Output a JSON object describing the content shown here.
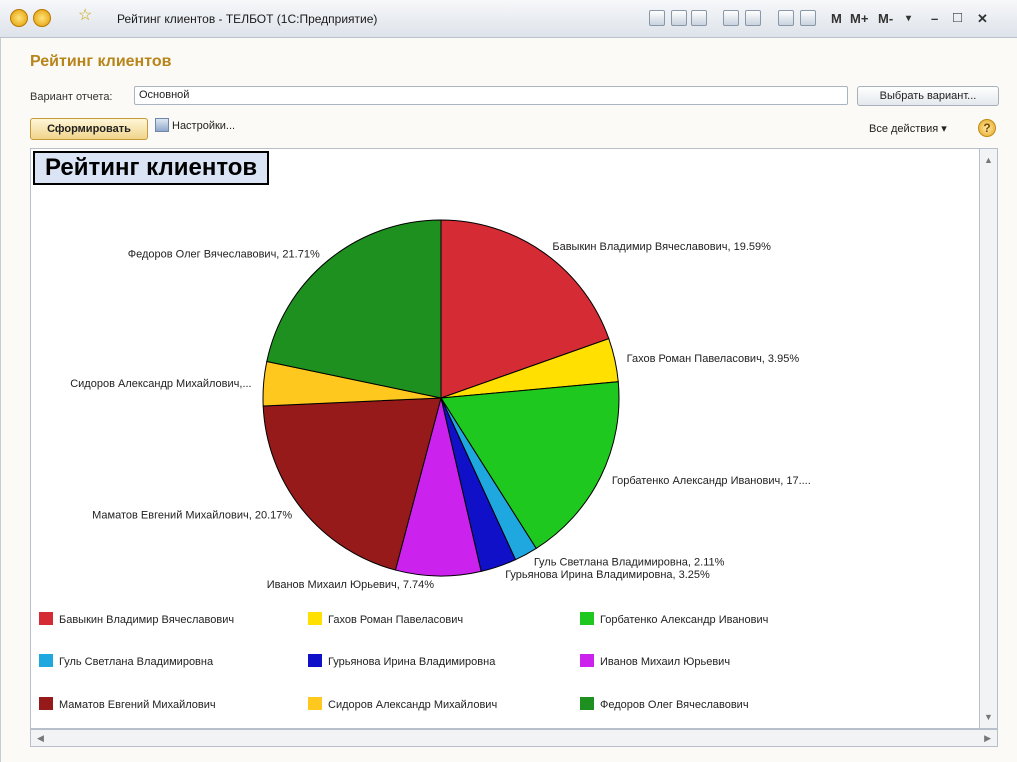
{
  "window": {
    "title": "Рейтинг клиентов - ТЕЛБОТ  (1С:Предприятие)",
    "toolbar_texts": [
      "M",
      "M+",
      "M-"
    ],
    "controls": [
      "minimize",
      "maximize",
      "close"
    ]
  },
  "form": {
    "heading": "Рейтинг клиентов",
    "variant_label": "Вариант отчета:",
    "variant_value": "Основной",
    "choose_variant_label": "Выбрать вариант...",
    "generate_label": "Сформировать",
    "settings_label": "Настройки...",
    "all_actions_label": "Все действия ▾",
    "help_label": "?"
  },
  "report": {
    "title": "Рейтинг клиентов"
  },
  "chart_data": {
    "type": "pie",
    "slices": [
      {
        "name": "Бавыкин Владимир Вячеславович",
        "percent": 19.59,
        "label": "Бавыкин Владимир Вячеславович, 19.59%",
        "color": "#d42b35"
      },
      {
        "name": "Гахов Роман Павеласович",
        "percent": 3.95,
        "label": "Гахов Роман Павеласович, 3.95%",
        "color": "#ffe000"
      },
      {
        "name": "Горбатенко Александр Иванович",
        "percent": 17.48,
        "label": "Горбатенко  Александр  Иванович, 17....",
        "color": "#1ec81e"
      },
      {
        "name": "Гуль Светлана Владимировна",
        "percent": 2.11,
        "label": "Гуль Светлана Владимировна, 2.11%",
        "color": "#1fa8e0"
      },
      {
        "name": "Гурьянова Ирина Владимировна",
        "percent": 3.25,
        "label": "Гурьянова Ирина Владимировна, 3.25%",
        "color": "#1010c8"
      },
      {
        "name": "Иванов Михаил Юрьевич",
        "percent": 7.74,
        "label": "Иванов Михаил Юрьевич, 7.74%",
        "color": "#cc22ee"
      },
      {
        "name": "Маматов Евгений Михайлович",
        "percent": 20.17,
        "label": "Маматов Евгений Михайлович, 20.17%",
        "color": "#971a1a"
      },
      {
        "name": "Сидоров Александр Михайлович",
        "percent": 4.0,
        "label": "Сидоров Александр Михайлович,...",
        "color": "#ffc81e"
      },
      {
        "name": "Федоров Олег Вячеславович",
        "percent": 21.71,
        "label": "Федоров Олег Вячеславович, 21.71%",
        "color": "#1e9020"
      }
    ],
    "legend": {
      "placement": "bottom",
      "columns": 3
    }
  }
}
